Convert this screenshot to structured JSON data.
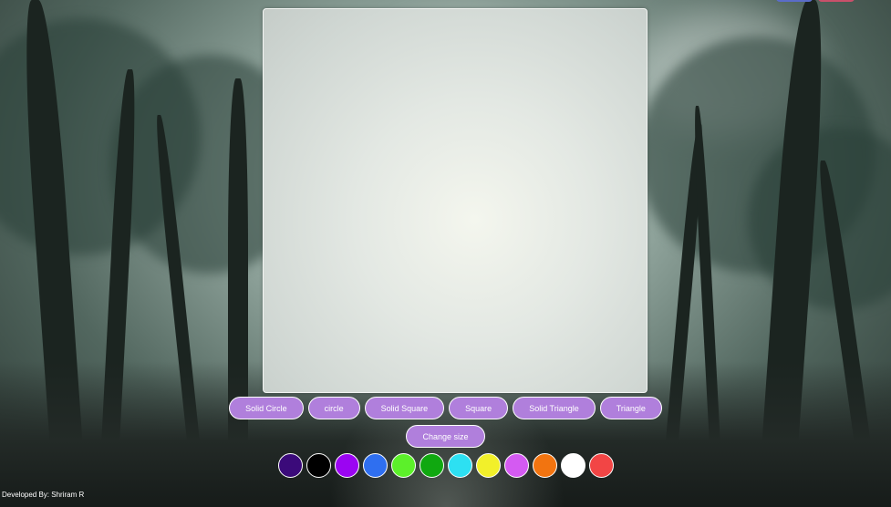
{
  "shape_buttons": [
    {
      "label": "Solid Circle"
    },
    {
      "label": "circle"
    },
    {
      "label": "Solid Square"
    },
    {
      "label": "Square"
    },
    {
      "label": "Solid Triangle"
    },
    {
      "label": "Triangle"
    }
  ],
  "size_button": {
    "label": "Change size"
  },
  "palette": [
    {
      "color": "#3b0a7a",
      "name": "dark-purple"
    },
    {
      "color": "#000000",
      "name": "black"
    },
    {
      "color": "#9b05f2",
      "name": "purple"
    },
    {
      "color": "#2f6ff0",
      "name": "blue"
    },
    {
      "color": "#5cf02a",
      "name": "lime"
    },
    {
      "color": "#10a810",
      "name": "green"
    },
    {
      "color": "#2de0f2",
      "name": "cyan"
    },
    {
      "color": "#f2f02a",
      "name": "yellow"
    },
    {
      "color": "#d45af2",
      "name": "magenta"
    },
    {
      "color": "#f27410",
      "name": "orange"
    },
    {
      "color": "#ffffff",
      "name": "white"
    },
    {
      "color": "#f24545",
      "name": "red"
    }
  ],
  "accent_color": "#b07fdc",
  "footer": {
    "credit": "Developed By: Shriram R"
  }
}
